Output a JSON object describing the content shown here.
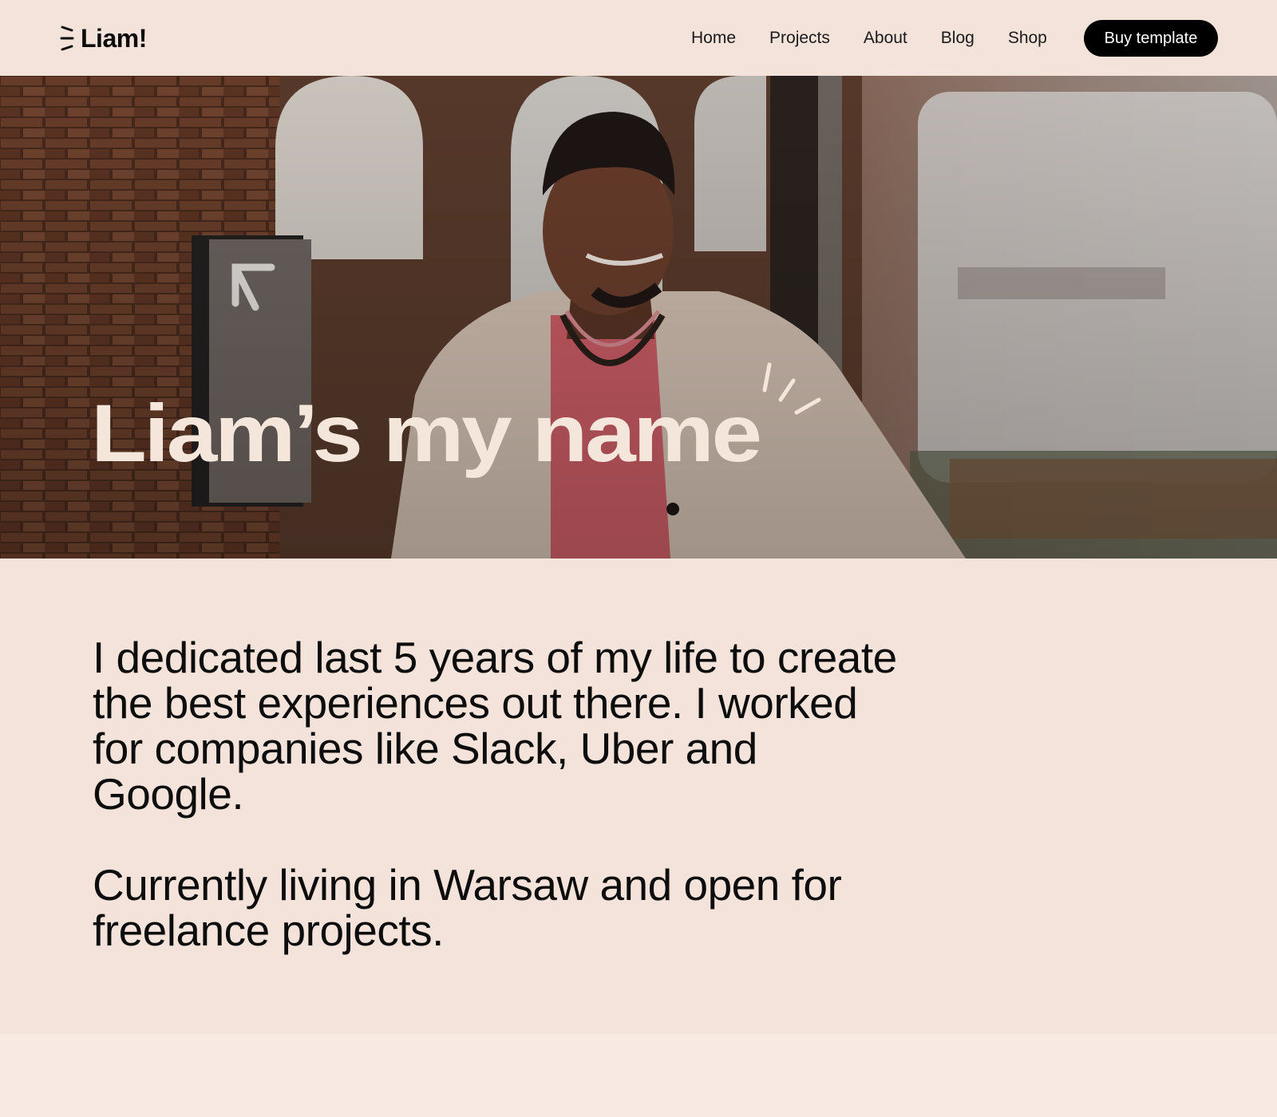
{
  "header": {
    "logo_text": "Liam!",
    "nav": [
      {
        "label": "Home"
      },
      {
        "label": "Projects"
      },
      {
        "label": "About"
      },
      {
        "label": "Blog"
      },
      {
        "label": "Shop"
      }
    ],
    "cta_label": "Buy template"
  },
  "hero": {
    "title": "Liam’s my name",
    "image": "portrait-photo"
  },
  "intro": {
    "paragraph_1": "I dedicated last 5 years of my life to create the best experiences out there. I worked for companies like Slack, Uber and Google.",
    "paragraph_2": "Currently living in Warsaw and open for freelance projects."
  },
  "colors": {
    "background": "#f3e3da",
    "button": "#000000",
    "hero_text": "#f5e6dc"
  }
}
